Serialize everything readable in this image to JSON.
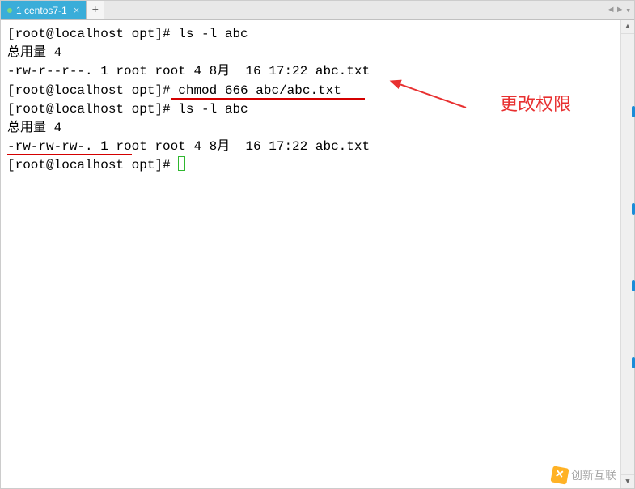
{
  "tabs": {
    "active": {
      "label": "1 centos7-1"
    },
    "new_tab_symbol": "+"
  },
  "terminal": {
    "lines": {
      "l1_prompt": "[root@localhost opt]# ",
      "l1_cmd": "ls -l abc",
      "l2": "总用量 4",
      "l3": "-rw-r--r--. 1 root root 4 8月  16 17:22 abc.txt",
      "l4_prompt": "[root@localhost opt]#",
      "l4_cmd": " chmod 666 abc/abc.txt",
      "l5_prompt": "[root@localhost opt]# ",
      "l5_cmd": "ls -l abc",
      "l6": "总用量 4",
      "l7_perm": "-rw-rw-rw-. 1 ro",
      "l7_rest": "ot root 4 8月  16 17:22 abc.txt",
      "l8_prompt": "[root@localhost opt]# "
    }
  },
  "annotation": {
    "text": "更改权限"
  },
  "watermark": {
    "text": "创新互联"
  },
  "nav_arrows": {
    "left": "◄",
    "right": "►",
    "dropdown": "▾"
  },
  "scroll": {
    "up": "▲",
    "down": "▼"
  }
}
